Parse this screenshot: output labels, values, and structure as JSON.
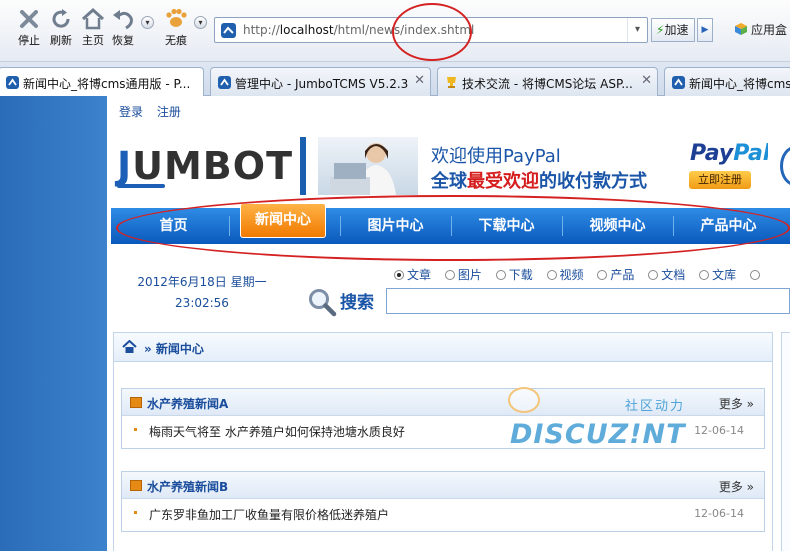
{
  "toolbar": {
    "buttons": [
      {
        "label": "停止",
        "icon": "stop-icon"
      },
      {
        "label": "刷新",
        "icon": "refresh-icon"
      },
      {
        "label": "主页",
        "icon": "home-icon"
      },
      {
        "label": "恢复",
        "icon": "restore-icon"
      },
      {
        "label": "无痕",
        "icon": "incognito-icon"
      }
    ],
    "url_prefix": "http://",
    "url_host": "localhost",
    "url_path": "/html/news/index.shtml",
    "speedup_label": "加速",
    "app_box_label": "应用盒"
  },
  "tabs": [
    {
      "title": "新闻中心_将博cms通用版 - P...",
      "active": true
    },
    {
      "title": "管理中心 - JumboTCMS V5.2.3",
      "active": false
    },
    {
      "title": "技术交流 - 将博CMS论坛 ASP...",
      "active": false
    },
    {
      "title": "新闻中心_将博cms通用...",
      "active": false
    }
  ],
  "site": {
    "top_links": [
      "登录",
      "注册"
    ],
    "logo_text": "JUMBOT",
    "banner": {
      "line1": "欢迎使用PayPal",
      "line2_a": "全球",
      "line2_b": "最受欢迎",
      "line2_c": "的收付款方式",
      "brand_a": "Pay",
      "brand_b": "Pal",
      "register": "立即注册"
    },
    "nav": [
      "首页",
      "新闻中心",
      "图片中心",
      "下载中心",
      "视频中心",
      "产品中心"
    ],
    "nav_active": "新闻中心",
    "date": "2012年6月18日  星期一",
    "time": "23:02:56",
    "search_types": [
      "文章",
      "图片",
      "下载",
      "视频",
      "产品",
      "文档",
      "文库"
    ],
    "search_selected": "文章",
    "search_label": "搜索",
    "breadcrumb": "» 新闻中心",
    "sections": [
      {
        "title": "水产养殖新闻A",
        "more": "更多 »",
        "items": [
          {
            "title": "梅雨天气将至  水产养殖户如何保持池塘水质良好",
            "date": "12-06-14"
          }
        ]
      },
      {
        "title": "水产养殖新闻B",
        "more": "更多 »",
        "items": [
          {
            "title": "广东罗非鱼加工厂收鱼量有限价格低迷养殖户",
            "date": "12-06-14"
          }
        ]
      }
    ]
  },
  "watermark": {
    "cn": "社区动力",
    "brand": "DISCUZ!NT"
  },
  "colors": {
    "nav_blue": "#0a59bc",
    "nav_active": "#f07a00",
    "annotation_red": "#d42222",
    "link_blue": "#1a4d9c"
  }
}
